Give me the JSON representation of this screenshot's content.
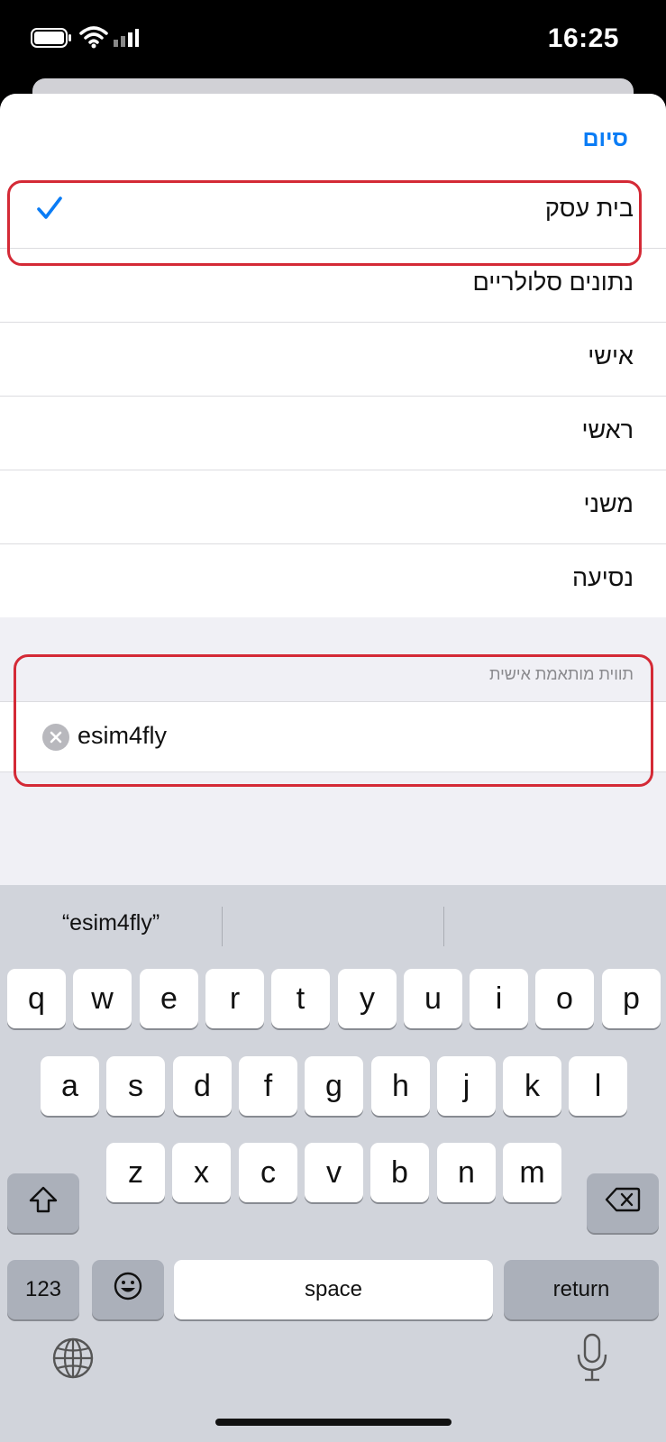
{
  "status_bar": {
    "time": "16:25",
    "icons": [
      "battery-icon",
      "wifi-icon",
      "cellular-icon"
    ]
  },
  "sheet": {
    "done_label": "סיום",
    "labels": [
      {
        "label": "בית עסק",
        "selected": true
      },
      {
        "label": "נתונים סלולריים",
        "selected": false
      },
      {
        "label": "אישי",
        "selected": false
      },
      {
        "label": "ראשי",
        "selected": false
      },
      {
        "label": "משני",
        "selected": false
      },
      {
        "label": "נסיעה",
        "selected": false
      }
    ],
    "custom_label_header": "תווית מותאמת אישית",
    "custom_label_value": "esim4fly"
  },
  "keyboard": {
    "suggestions": [
      "“esim4fly”",
      "",
      ""
    ],
    "row1": [
      "q",
      "w",
      "e",
      "r",
      "t",
      "y",
      "u",
      "i",
      "o",
      "p"
    ],
    "row2": [
      "a",
      "s",
      "d",
      "f",
      "g",
      "h",
      "j",
      "k",
      "l"
    ],
    "row3": [
      "z",
      "x",
      "c",
      "v",
      "b",
      "n",
      "m"
    ],
    "numbers_label": "123",
    "space_label": "space",
    "return_label": "return",
    "icons": [
      "shift-icon",
      "backspace-icon",
      "emoji-icon",
      "globe-icon",
      "microphone-icon"
    ]
  },
  "colors": {
    "accent": "#0a7cf5",
    "annotation": "#d42a36",
    "keyboard_bg": "#d1d4db"
  }
}
